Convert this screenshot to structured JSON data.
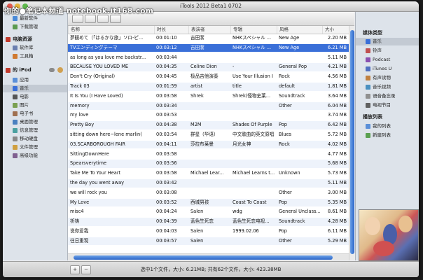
{
  "watermark": "你的●笔记本频道 notebook.it168.com",
  "window": {
    "title": "iTools 2012 Beta1 0702"
  },
  "sidebar": {
    "items": [
      {
        "label": "最新软件",
        "icon": "new-software-icon",
        "color": "#4a8ad8"
      },
      {
        "label": "下载管理",
        "icon": "download-icon",
        "color": "#5a9a50"
      },
      {
        "label": "电脑资源",
        "icon": "computer-icon",
        "color": "#c23a2b",
        "header": true
      },
      {
        "label": "软件库",
        "icon": "software-library-icon",
        "color": "#6a7fb0"
      },
      {
        "label": "工具箱",
        "icon": "toolbox-icon",
        "color": "#d07a30"
      },
      {
        "label": "的 iPod",
        "icon": "ipod-icon",
        "color": "#c23a2b",
        "header": true
      },
      {
        "label": "应用",
        "icon": "apps-icon",
        "color": "#5a8fd8"
      },
      {
        "label": "音乐",
        "icon": "music-icon",
        "color": "#3a6fd8",
        "selected": true
      },
      {
        "label": "电影",
        "icon": "movie-icon",
        "color": "#555555"
      },
      {
        "label": "图片",
        "icon": "photo-icon",
        "color": "#7aa050"
      },
      {
        "label": "电子书",
        "icon": "ebook-icon",
        "color": "#a07050"
      },
      {
        "label": "桌面管理",
        "icon": "desktop-icon",
        "color": "#4a80c0"
      },
      {
        "label": "信息管理",
        "icon": "info-icon",
        "color": "#4aa0a0"
      },
      {
        "label": "移动硬盘",
        "icon": "drive-icon",
        "color": "#888888"
      },
      {
        "label": "文件管理",
        "icon": "folder-icon",
        "color": "#d0a040"
      },
      {
        "label": "高级功能",
        "icon": "advanced-icon",
        "color": "#806090"
      }
    ]
  },
  "table": {
    "columns": [
      "名称",
      "时长",
      "表演者",
      "专辑",
      "风格",
      "大小"
    ],
    "rows": [
      [
        "夢観めて（「はるかな旅」ソロ-ピ...",
        "00:01:10",
        "吉田潔",
        "NHKスペシャル ...",
        "New Age",
        "2.20 MB"
      ],
      [
        "TVエンディングテーマ",
        "00:03:12",
        "吉田潔",
        "NHKスペシャル ...",
        "New Age",
        "6.21 MB"
      ],
      [
        "as long as you love me backstr...",
        "00:03:44",
        "",
        "",
        "",
        "5.11 MB"
      ],
      [
        "BECAUSE YOU LOVED ME",
        "00:04:35",
        "Celine Dion",
        "-",
        "General Pop",
        "4.21 MB"
      ],
      [
        "Don't Cry (Original)",
        "00:04:45",
        "极品吉他演奏",
        "Use Your Illusion I",
        "Rock",
        "4.56 MB"
      ],
      [
        "Track 03",
        "00:01:59",
        "artist",
        "title",
        "default",
        "1.81 MB"
      ],
      [
        "It Is You (I Have Loved)",
        "00:03:58",
        "Shrek",
        "Shrek(怪物史莱...",
        "Soundtrack",
        "3.64 MB"
      ],
      [
        "memory",
        "00:03:34",
        "",
        "",
        "Other",
        "6.04 MB"
      ],
      [
        "my love",
        "00:03:53",
        "",
        "",
        "",
        "3.74 MB"
      ],
      [
        "Pretty Boy",
        "00:04:38",
        "M2M",
        "Shades Of Purple",
        "Pop",
        "6.42 MB"
      ],
      [
        "sitting down here~lene marlin(",
        "00:03:54",
        "群星（华语）",
        "中文歌曲的英文原唱",
        "Blues",
        "5.72 MB"
      ],
      [
        "03.SCARBOROUGH FAIR",
        "00:04:11",
        "莎拉布莱曼",
        "月光女神",
        "Rock",
        "4.02 MB"
      ],
      [
        "SittingDownHere",
        "00:03:58",
        "",
        "",
        "",
        "4.77 MB"
      ],
      [
        "Spearsverytime",
        "00:03:56",
        "",
        "",
        "",
        "5.68 MB"
      ],
      [
        "Take Me To Your Heart",
        "00:03:58",
        "Michael Lear...",
        "Michael Learns t...",
        "Unknown",
        "5.73 MB"
      ],
      [
        "the day you went away",
        "00:03:42",
        "",
        "",
        "",
        "5.11 MB"
      ],
      [
        "we will rock you",
        "00:03:08",
        "",
        "",
        "Other",
        "3.00 MB"
      ],
      [
        "My Love",
        "00:03:52",
        "西城男孩",
        "Coast To Coast",
        "Pop",
        "5.35 MB"
      ],
      [
        "misc4",
        "00:04:24",
        "Salen",
        "wdg",
        "General Unclass...",
        "8.61 MB"
      ],
      [
        "祈祷",
        "00:04:39",
        "蓝色生死恋",
        "蓝色生死恋电视...",
        "Soundtrack",
        "4.28 MB"
      ],
      [
        "说你爱我",
        "00:04:03",
        "Salen",
        "1999.02.06",
        "Pop",
        "6.11 MB"
      ],
      [
        "往日重现",
        "00:03:57",
        "Salen",
        "",
        "Other",
        "5.29 MB"
      ]
    ],
    "selected_row": 1
  },
  "right_panel": {
    "media_header": "媒体类型",
    "media_items": [
      {
        "label": "音乐",
        "icon": "music-note-icon",
        "color": "#3a6fd8",
        "selected": true
      },
      {
        "label": "铃声",
        "icon": "ringtone-icon",
        "color": "#c05050"
      },
      {
        "label": "Podcast",
        "icon": "podcast-icon",
        "color": "#8a50b0"
      },
      {
        "label": "iTunes U",
        "icon": "itunes-u-icon",
        "color": "#5070c0"
      },
      {
        "label": "有声读物",
        "icon": "audiobook-icon",
        "color": "#c08040"
      },
      {
        "label": "音乐视频",
        "icon": "music-video-icon",
        "color": "#4a90c0"
      },
      {
        "label": "语音备忘录",
        "icon": "voice-memo-icon",
        "color": "#909090"
      },
      {
        "label": "电视节目",
        "icon": "tv-icon",
        "color": "#606060"
      }
    ],
    "playlist_header": "播放列表",
    "playlists": [
      {
        "label": "我的列表",
        "icon": "playlist-icon",
        "color": "#5a8fd8"
      },
      {
        "label": "新建列表",
        "icon": "add-playlist-icon",
        "color": "#5aa050"
      }
    ]
  },
  "status": {
    "text": "选中1个文件，大小: 6.21MB;  共有62个文件，大小: 423.38MB"
  }
}
